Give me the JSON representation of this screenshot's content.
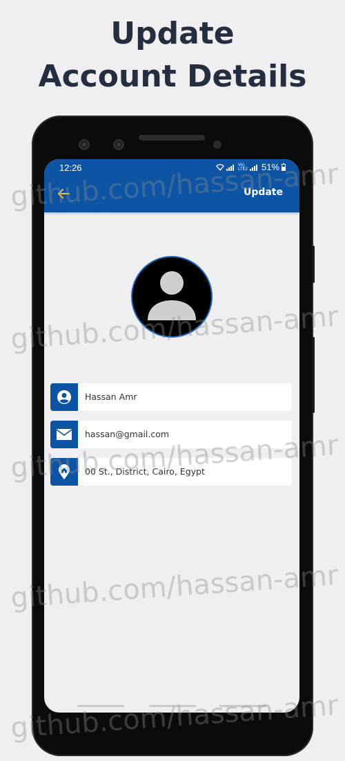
{
  "headline": {
    "line1": "Update",
    "line2": "Account Details"
  },
  "statusbar": {
    "time": "12:26",
    "network": "Vo) LTE2",
    "battery": "51%"
  },
  "appbar": {
    "back_icon": "arrow-left-icon",
    "update_label": "Update",
    "background": "#0d55a4",
    "back_icon_color": "#f0c24a"
  },
  "avatar": {
    "icon": "person-icon"
  },
  "fields": [
    {
      "icon": "account-circle-icon",
      "value": "Hassan Amr"
    },
    {
      "icon": "email-icon",
      "value": "hassan@gmail.com"
    },
    {
      "icon": "home-location-icon",
      "value": "00 St., District, Cairo, Egypt"
    }
  ],
  "watermark": "github.com/hassan-amr"
}
